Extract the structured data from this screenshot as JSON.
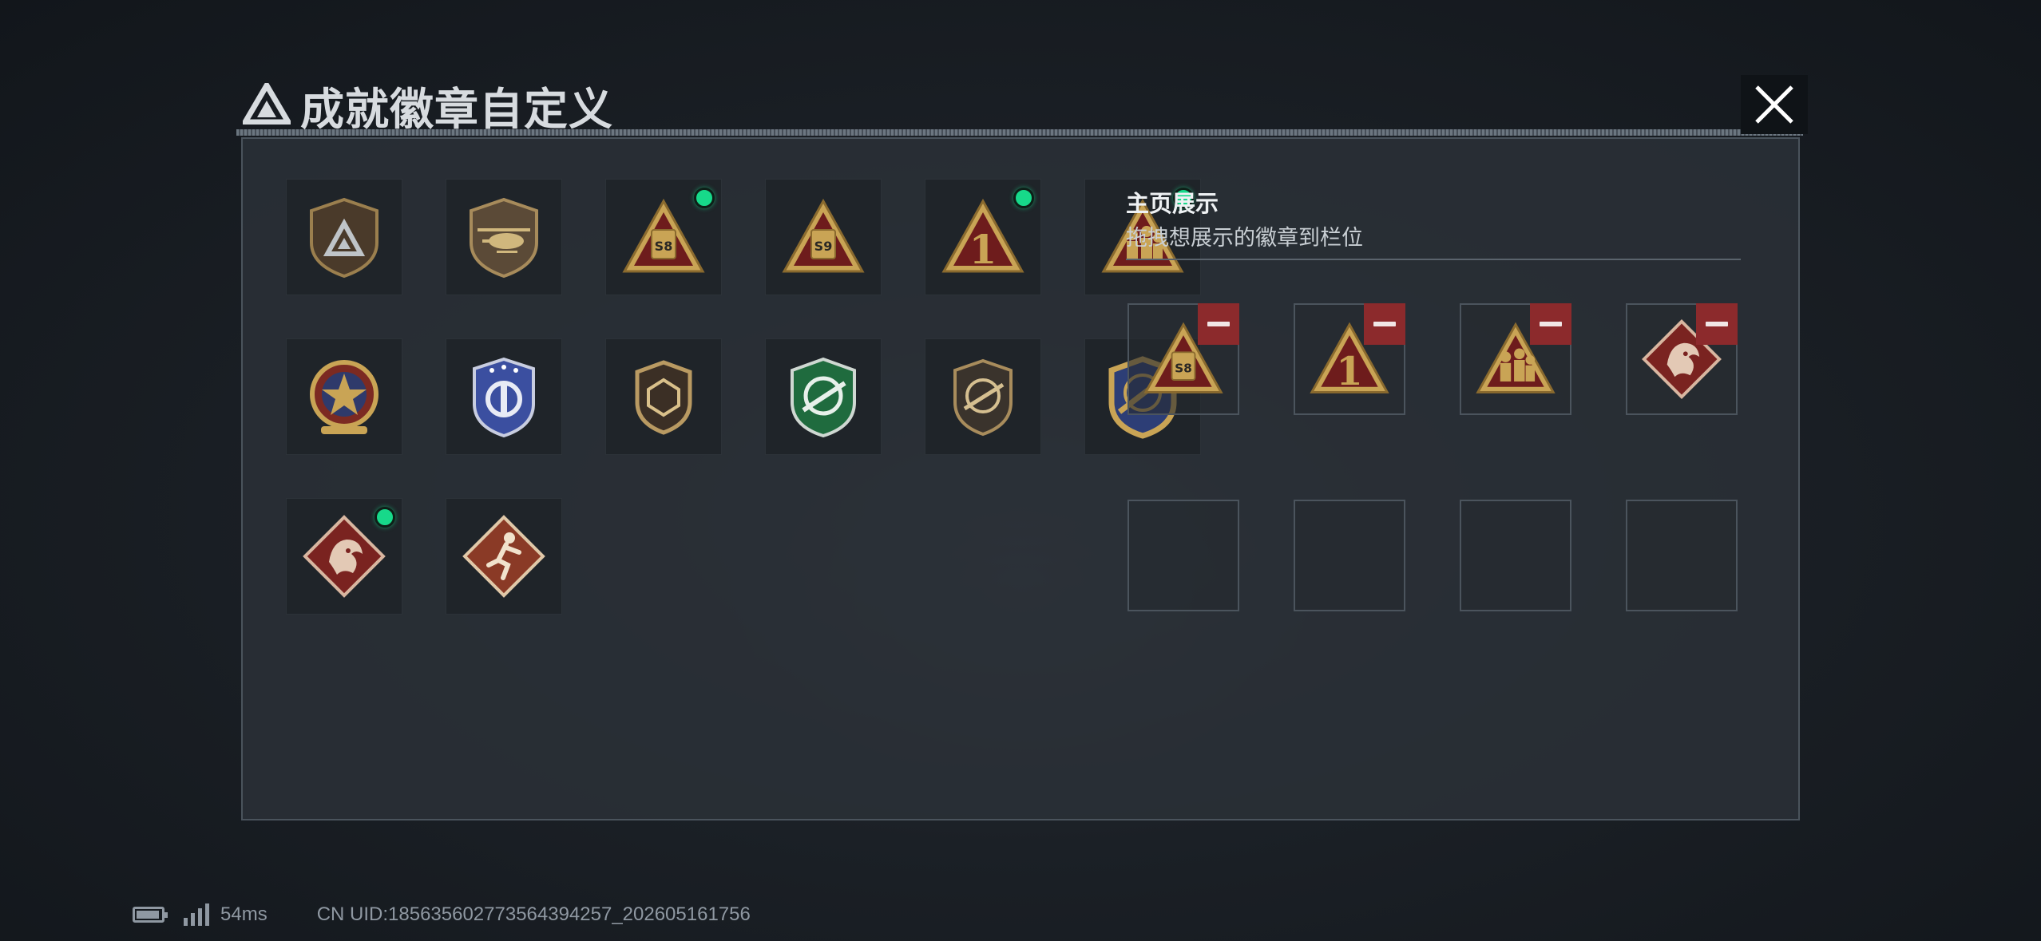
{
  "header": {
    "title": "成就徽章自定义",
    "tag": ""
  },
  "showcase": {
    "title": "主页展示",
    "subtitle": "拖拽想展示的徽章到栏位"
  },
  "badges": [
    {
      "icon": "tri-shield-badge",
      "new": false
    },
    {
      "icon": "helicopter-badge",
      "new": false
    },
    {
      "icon": "tri-s8-badge",
      "new": true,
      "label": "S8"
    },
    {
      "icon": "tri-s9-badge",
      "new": false,
      "label": "S9"
    },
    {
      "icon": "tri-number-one-badge",
      "new": true,
      "label": "1"
    },
    {
      "icon": "tri-soldiers-badge",
      "new": true
    },
    {
      "icon": "star-medal-badge",
      "new": false
    },
    {
      "icon": "blue-shield-badge",
      "new": false
    },
    {
      "icon": "hexagon-shield-badge",
      "new": false
    },
    {
      "icon": "green-crosshair-badge",
      "new": false
    },
    {
      "icon": "dark-crosshair-badge",
      "new": false
    },
    {
      "icon": "gold-rifle-badge",
      "new": false
    },
    {
      "icon": "dragon-diamond-badge",
      "new": true
    },
    {
      "icon": "runner-diamond-badge",
      "new": false
    }
  ],
  "slots": [
    {
      "icon": "tri-s8-badge",
      "label": "S8"
    },
    {
      "icon": "tri-number-one-badge",
      "label": "1"
    },
    {
      "icon": "tri-soldiers-badge"
    },
    {
      "icon": "dragon-diamond-badge"
    },
    null,
    null,
    null,
    null
  ],
  "footer": {
    "ping": "54ms",
    "uid": "CN UID:185635602773564394257_202605161756"
  },
  "colors": {
    "accent_green": "#17d98a",
    "remove_red": "#8c2a2c",
    "gold": "#c9a455",
    "crimson": "#7a1f1f"
  }
}
